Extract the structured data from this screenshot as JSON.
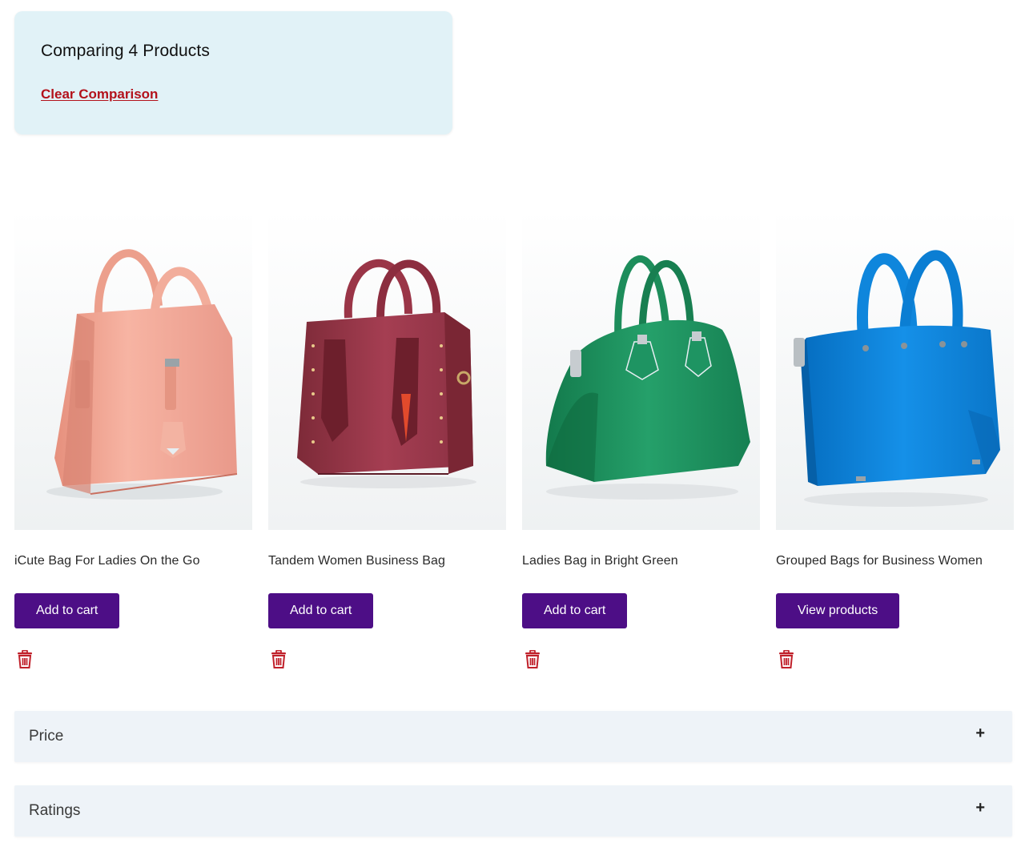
{
  "comparison": {
    "title": "Comparing 4 Products",
    "clear_label": "Clear Comparison"
  },
  "products": [
    {
      "name": "iCute Bag For Ladies On the Go",
      "button_label": "Add to cart",
      "remove_icon": "trash-icon",
      "bag_color": "#f2a99a"
    },
    {
      "name": "Tandem Women Business Bag",
      "button_label": "Add to cart",
      "remove_icon": "trash-icon",
      "bag_color": "#9c3a4d"
    },
    {
      "name": "Ladies Bag in Bright Green",
      "button_label": "Add to cart",
      "remove_icon": "trash-icon",
      "bag_color": "#1f8d5c"
    },
    {
      "name": "Grouped Bags for Business Women",
      "button_label": "View products",
      "remove_icon": "trash-icon",
      "bag_color": "#0a7fd6"
    }
  ],
  "sections": [
    {
      "title": "Price",
      "toggle": "+"
    },
    {
      "title": "Ratings",
      "toggle": "+"
    }
  ],
  "colors": {
    "header_bg": "#e1f2f7",
    "link": "#b3121b",
    "button": "#4d0e86",
    "accordion_bg": "#eef3f8"
  }
}
